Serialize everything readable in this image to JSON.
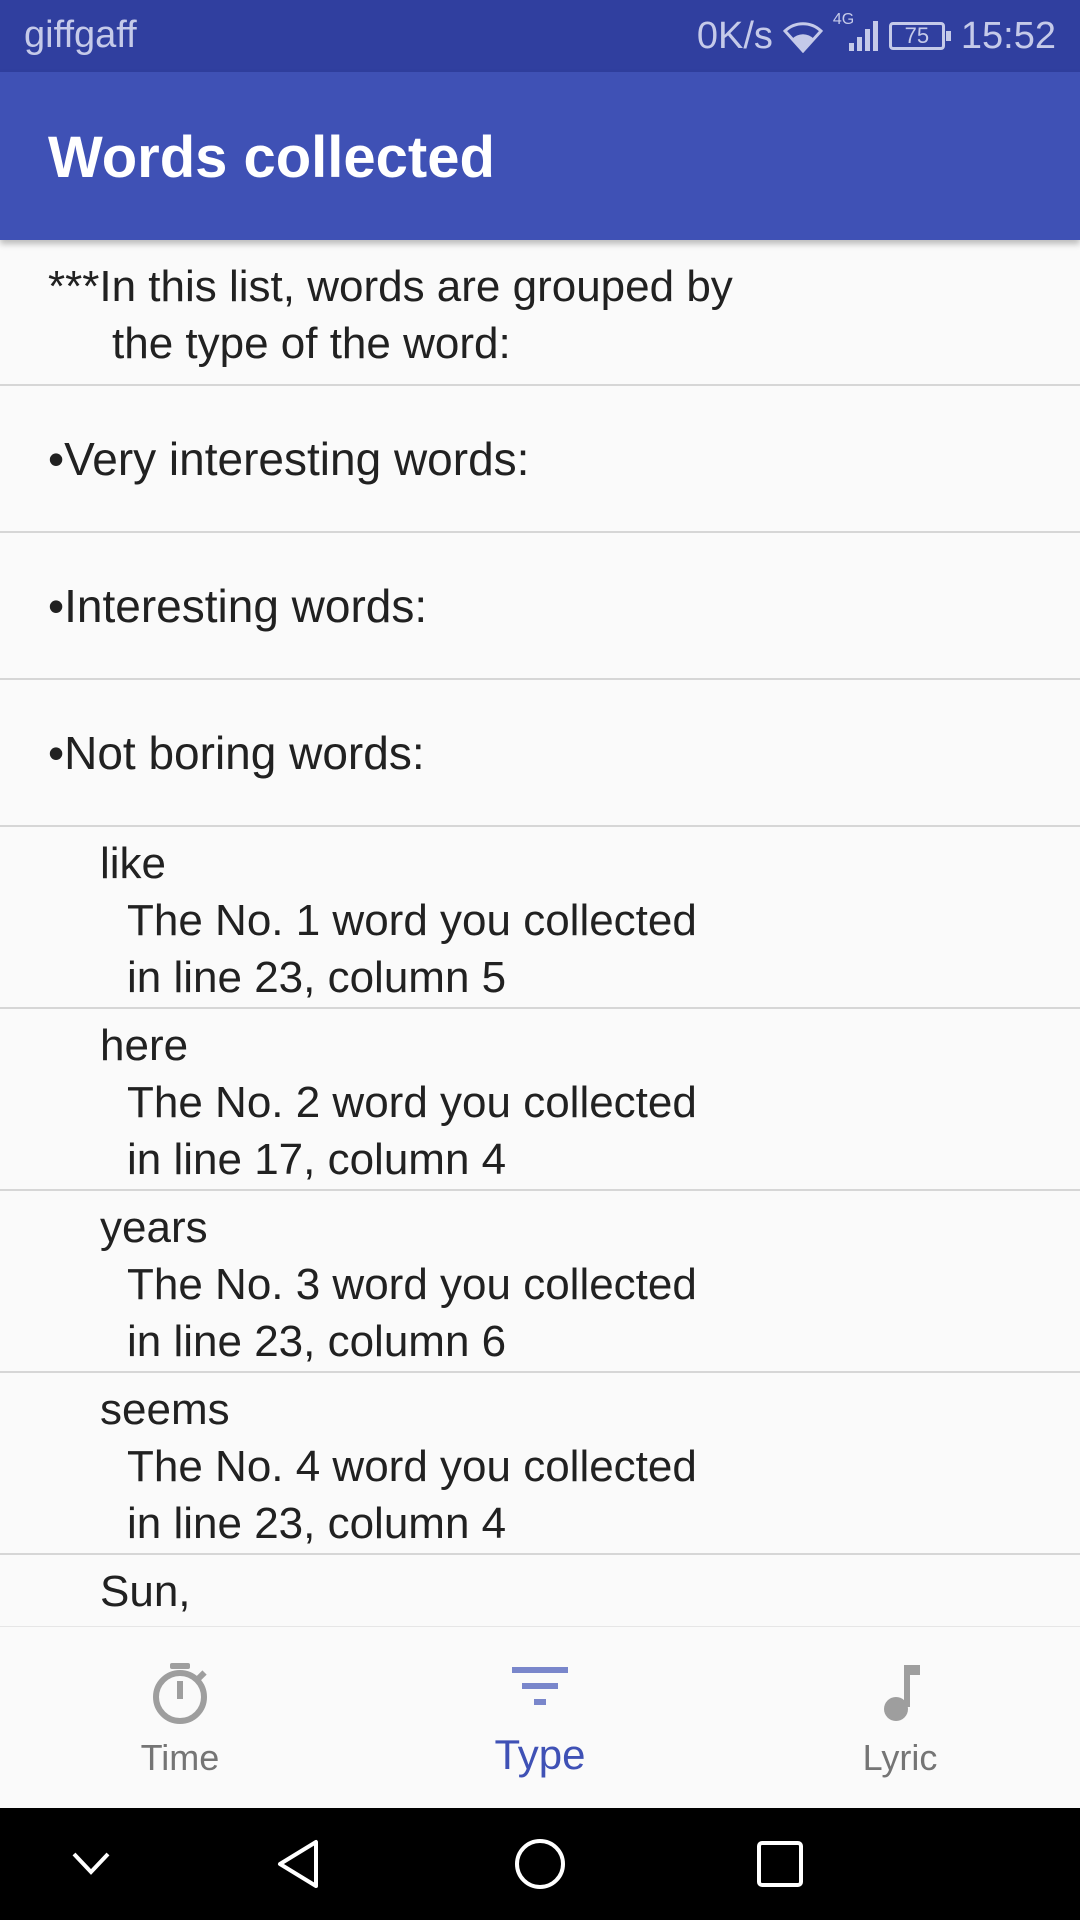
{
  "status_bar": {
    "carrier": "giffgaff",
    "speed": "0K/s",
    "network": "4G",
    "battery": "75",
    "time": "15:52"
  },
  "app_bar": {
    "title": "Words collected"
  },
  "intro": {
    "line1": "***In this list, words are grouped by",
    "line2": "the type of the word:"
  },
  "sections": [
    {
      "label": "•Very interesting words:"
    },
    {
      "label": "•Interesting words:"
    },
    {
      "label": "•Not boring words:"
    }
  ],
  "words": [
    {
      "word": "like",
      "rank": "The No. 1 word you collected",
      "location": "in line 23, column 5"
    },
    {
      "word": "here",
      "rank": "The No. 2 word you collected",
      "location": "in line 17, column 4"
    },
    {
      "word": "years",
      "rank": "The No. 3 word you collected",
      "location": "in line 23, column 6"
    },
    {
      "word": "seems",
      "rank": "The No. 4 word you collected",
      "location": "in line 23, column 4"
    },
    {
      "word": "Sun,",
      "rank": "",
      "location": ""
    }
  ],
  "bottom_nav": {
    "items": [
      {
        "label": "Time",
        "icon": "timer-icon"
      },
      {
        "label": "Type",
        "icon": "filter-icon"
      },
      {
        "label": "Lyric",
        "icon": "music-note-icon"
      }
    ],
    "active": "Type"
  },
  "colors": {
    "primary": "#3f51b5",
    "primary_dark": "#303f9f",
    "inactive": "#757575"
  }
}
